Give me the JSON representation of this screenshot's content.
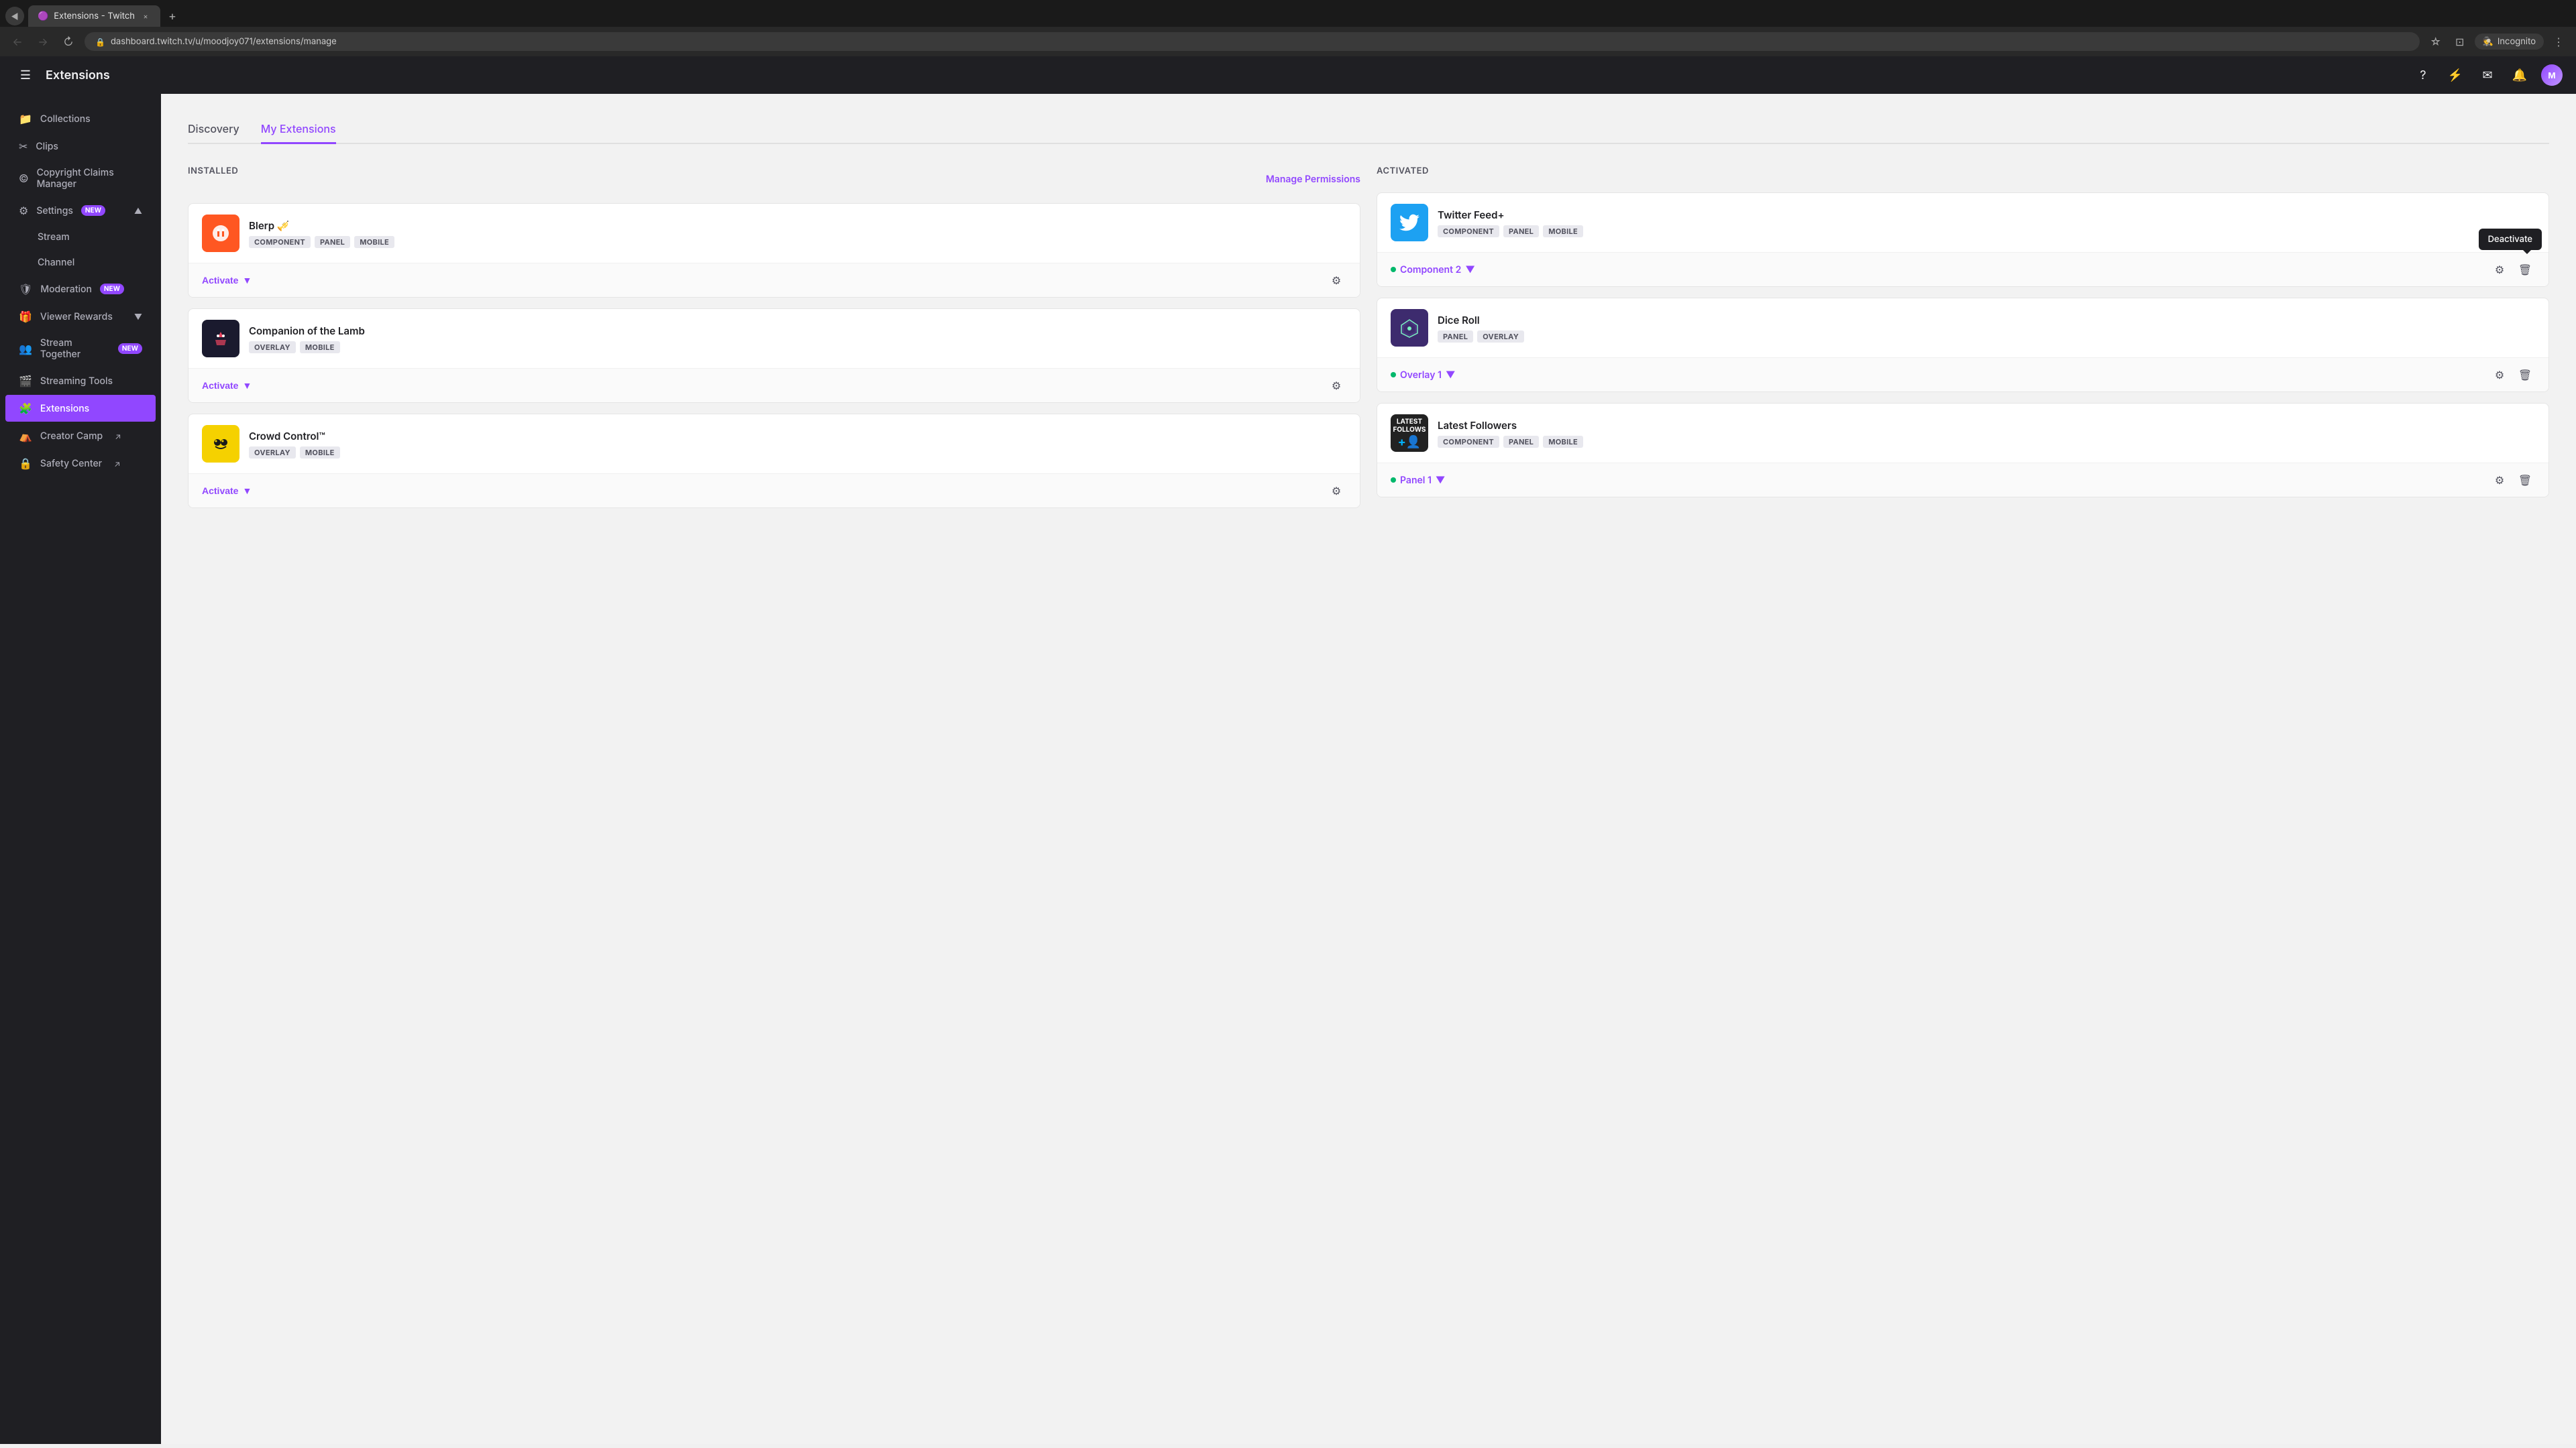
{
  "browser": {
    "tab_title": "Extensions - Twitch",
    "tab_favicon": "🟣",
    "url": "dashboard.twitch.tv/u/moodjoy071/extensions/manage",
    "new_tab_icon": "+",
    "nav_back": "←",
    "nav_forward": "→",
    "nav_refresh": "↻",
    "incognito_label": "Incognito",
    "close_icon": "×",
    "add_tab_icon": "+"
  },
  "header": {
    "title": "Extensions",
    "hamburger_icon": "☰",
    "help_icon": "?",
    "turbo_icon": "⚡",
    "notifications_icon": "✉",
    "alerts_icon": "🔔",
    "avatar_initials": "M"
  },
  "sidebar": {
    "items": [
      {
        "id": "collections",
        "label": "Collections",
        "icon": ""
      },
      {
        "id": "clips",
        "label": "Clips",
        "icon": ""
      },
      {
        "id": "copyright",
        "label": "Copyright Claims Manager",
        "icon": ""
      },
      {
        "id": "settings",
        "label": "Settings",
        "icon": "⚙",
        "badge": "NEW",
        "has_chevron": true
      },
      {
        "id": "stream",
        "label": "Stream",
        "icon": "",
        "sub": true
      },
      {
        "id": "channel",
        "label": "Channel",
        "icon": "",
        "sub": true
      },
      {
        "id": "moderation",
        "label": "Moderation",
        "icon": "",
        "badge": "NEW"
      },
      {
        "id": "viewer-rewards",
        "label": "Viewer Rewards",
        "icon": "🎁",
        "has_chevron": true
      },
      {
        "id": "stream-together",
        "label": "Stream Together",
        "icon": "👥",
        "badge": "NEW"
      },
      {
        "id": "streaming-tools",
        "label": "Streaming Tools",
        "icon": "🎬"
      },
      {
        "id": "extensions",
        "label": "Extensions",
        "icon": "🧩",
        "active": true
      },
      {
        "id": "creator-camp",
        "label": "Creator Camp",
        "icon": "",
        "external": true
      },
      {
        "id": "safety-center",
        "label": "Safety Center",
        "icon": "",
        "external": true
      }
    ]
  },
  "content": {
    "tabs": [
      {
        "id": "discovery",
        "label": "Discovery",
        "active": false
      },
      {
        "id": "my-extensions",
        "label": "My Extensions",
        "active": true
      }
    ],
    "installed_section": {
      "label": "Installed",
      "manage_permissions_label": "Manage Permissions"
    },
    "activated_section": {
      "label": "Activated"
    },
    "deactivate_tooltip": "Deactivate",
    "extensions_installed": [
      {
        "id": "blerp",
        "name": "Blerp 🎺",
        "tags": [
          "COMPONENT",
          "PANEL",
          "MOBILE"
        ],
        "icon_type": "blerp",
        "action_label": "Activate",
        "action_type": "activate"
      },
      {
        "id": "companion",
        "name": "Companion of the Lamb",
        "tags": [
          "OVERLAY",
          "MOBILE"
        ],
        "icon_type": "companion",
        "action_label": "Activate",
        "action_type": "activate"
      },
      {
        "id": "crowd-control",
        "name": "Crowd Control™",
        "tags": [
          "OVERLAY",
          "MOBILE"
        ],
        "icon_type": "crowd",
        "action_label": "Activate",
        "action_type": "activate"
      }
    ],
    "extensions_activated": [
      {
        "id": "twitter-feed",
        "name": "Twitter Feed+",
        "tags": [
          "COMPONENT",
          "PANEL",
          "MOBILE"
        ],
        "icon_type": "twitter",
        "status_label": "Component 2",
        "show_deactivate_tooltip": true
      },
      {
        "id": "dice-roll",
        "name": "Dice Roll",
        "tags": [
          "PANEL",
          "OVERLAY"
        ],
        "icon_type": "diceroll",
        "status_label": "Overlay 1",
        "show_deactivate_tooltip": false
      },
      {
        "id": "latest-followers",
        "name": "Latest Followers",
        "tags": [
          "COMPONENT",
          "PANEL",
          "MOBILE"
        ],
        "icon_type": "latest",
        "status_label": "Panel 1",
        "show_deactivate_tooltip": false
      }
    ]
  }
}
